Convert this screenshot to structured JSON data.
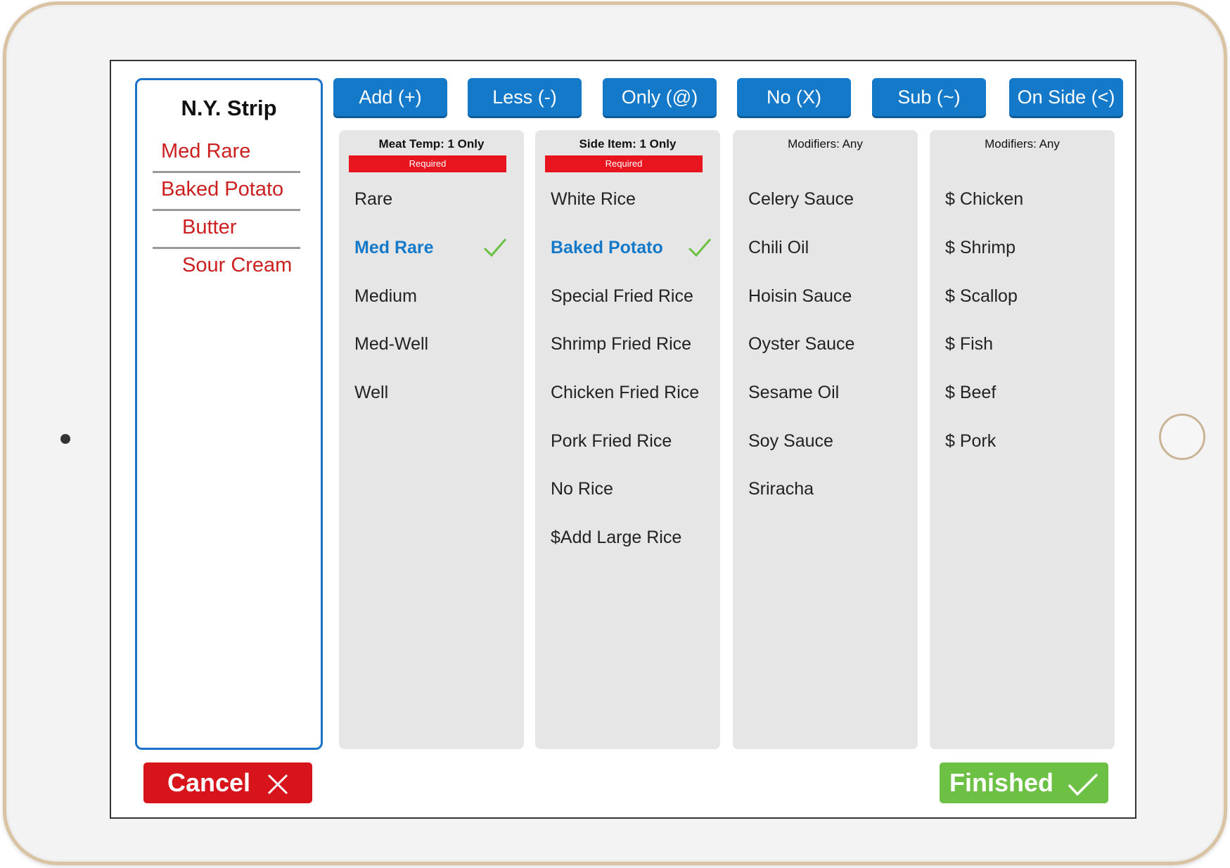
{
  "order": {
    "title": "N.Y. Strip",
    "items": [
      {
        "label": "Med Rare",
        "indent": false
      },
      {
        "label": "Baked Potato",
        "indent": false
      },
      {
        "label": "Butter",
        "indent": true
      },
      {
        "label": "Sour Cream",
        "indent": true
      }
    ]
  },
  "actions": [
    {
      "label": "Add (+)"
    },
    {
      "label": "Less (-)"
    },
    {
      "label": "Only (@)"
    },
    {
      "label": "No (X)"
    },
    {
      "label": "Sub (~)"
    },
    {
      "label": "On Side (<)"
    }
  ],
  "columns": [
    {
      "header": "Meat Temp: 1 Only",
      "required": "Required",
      "options": [
        "Rare",
        "Med Rare",
        "Medium",
        "Med-Well",
        "Well"
      ],
      "selected": "Med Rare"
    },
    {
      "header": "Side Item: 1 Only",
      "required": "Required",
      "options": [
        "White Rice",
        "Baked Potato",
        "Special Fried Rice",
        "Shrimp Fried Rice",
        "Chicken Fried Rice",
        "Pork Fried Rice",
        "No Rice",
        "$Add Large Rice"
      ],
      "selected": "Baked Potato"
    },
    {
      "header": "Modifiers: Any",
      "required": "",
      "options": [
        "Celery Sauce",
        "Chili Oil",
        "Hoisin Sauce",
        "Oyster Sauce",
        "Sesame Oil",
        "Soy Sauce",
        "Sriracha"
      ],
      "selected": ""
    },
    {
      "header": "Modifiers: Any",
      "required": "",
      "options": [
        "$ Chicken",
        "$ Shrimp",
        "$ Scallop",
        "$ Fish",
        "$ Beef",
        "$ Pork"
      ],
      "selected": ""
    }
  ],
  "footer": {
    "cancel_label": "Cancel",
    "finished_label": "Finished"
  },
  "colors": {
    "accent_blue": "#1479c9",
    "required_red": "#e8141e",
    "order_text_red": "#cc1f1f",
    "check_green": "#6cc144"
  },
  "icons": {
    "cancel": "close-icon",
    "finished": "checkmark-icon",
    "selected": "checkmark-icon"
  }
}
